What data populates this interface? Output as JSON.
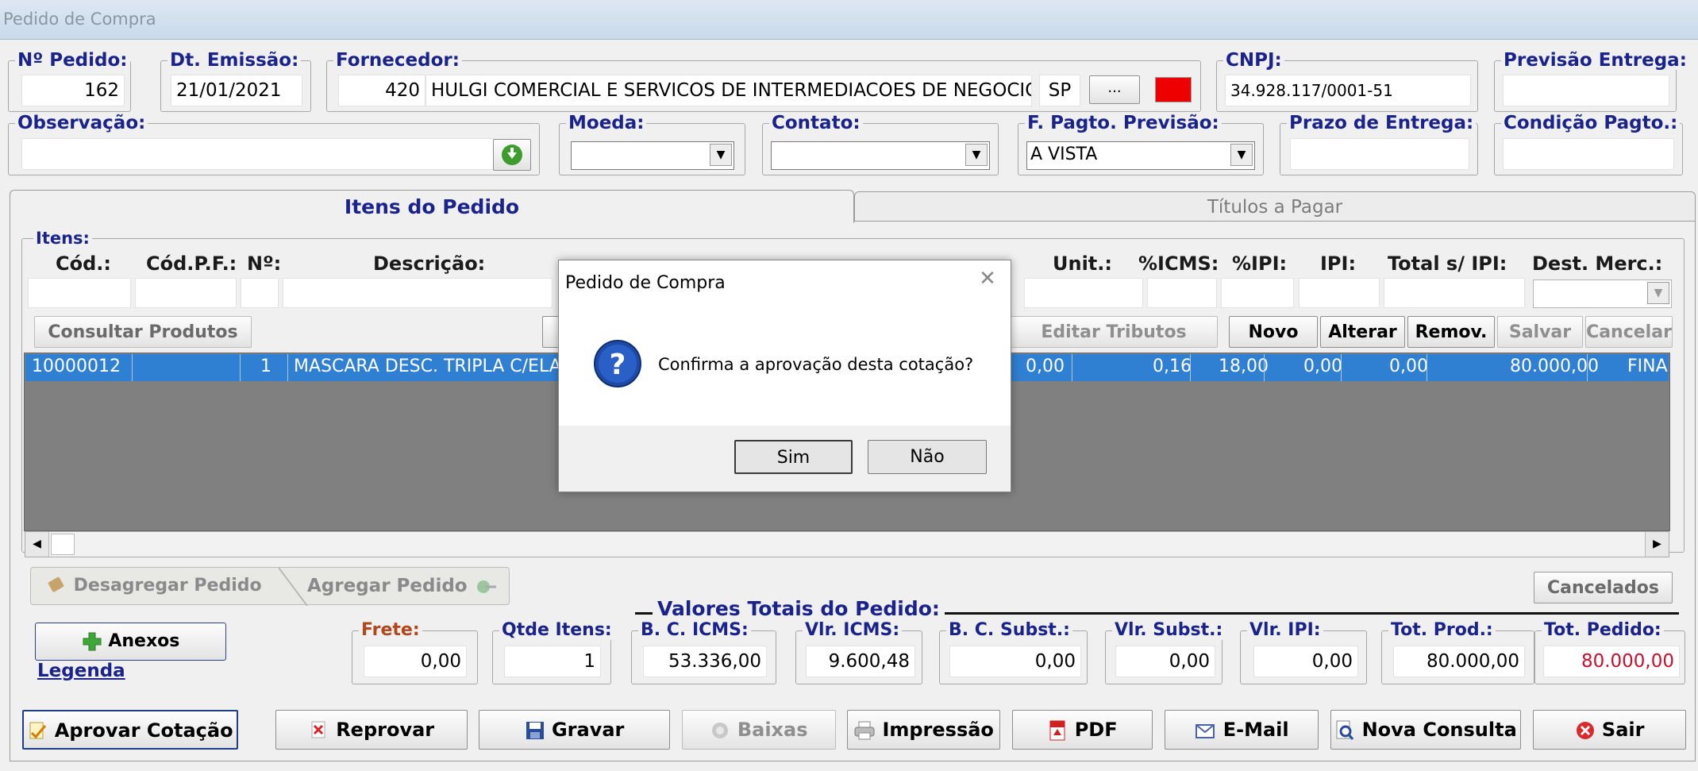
{
  "window_title": "Pedido de Compra",
  "header": {
    "pedido": {
      "label": "Nº Pedido:",
      "value": "162"
    },
    "emissao": {
      "label": "Dt. Emissão:",
      "value": "21/01/2021"
    },
    "fornecedor": {
      "label": "Fornecedor:",
      "code": "420",
      "name": "HULGI COMERCIAL E SERVICOS DE INTERMEDIACOES DE NEGOCIOS",
      "uf": "SP",
      "browse": "...",
      "color": "#ee0000"
    },
    "cnpj": {
      "label": "CNPJ:",
      "value": "34.928.117/0001-51"
    },
    "previsao": {
      "label": "Previsão Entrega:",
      "value": ""
    },
    "observacao": {
      "label": "Observação:",
      "value": ""
    },
    "moeda": {
      "label": "Moeda:",
      "value": ""
    },
    "contato": {
      "label": "Contato:",
      "value": ""
    },
    "fpagto": {
      "label": "F. Pagto. Previsão:",
      "value": "A VISTA"
    },
    "prazo": {
      "label": "Prazo de Entrega:",
      "value": ""
    },
    "condicao": {
      "label": "Condição Pagto.:",
      "value": ""
    }
  },
  "tabs": {
    "itens": "Itens do Pedido",
    "titulos": "Títulos a Pagar"
  },
  "itens": {
    "label": "Itens:",
    "columns": [
      "Cód.:",
      "Cód.P.F.:",
      "Nº:",
      "Descrição:",
      "Unit.:",
      "%ICMS:",
      "%IPI:",
      "IPI:",
      "Total s/ IPI:",
      "Dest. Merc.:"
    ],
    "buttons": {
      "consultar": "Consultar Produtos",
      "tributos": "Editar Tributos",
      "novo": "Novo",
      "alterar": "Alterar",
      "remov": "Remov.",
      "salvar": "Salvar",
      "cancelar": "Cancelar"
    },
    "rows": [
      {
        "cod": "10000012",
        "codpf": "",
        "num": "1",
        "desc": "MASCARA DESC. TRIPLA C/ELAS",
        "c1": "0,00",
        "c2": "0,16",
        "c3": "18,00",
        "c4": "0,00",
        "c5": "0,00",
        "total": "80.000,00",
        "dest": "FINA"
      }
    ]
  },
  "agg": {
    "desagregar": "Desagregar Pedido",
    "agregar": "Agregar Pedido",
    "cancelados": "Cancelados"
  },
  "anexos": "Anexos",
  "legenda": "Legenda",
  "totais": {
    "title": "Valores Totais do Pedido:",
    "frete": {
      "label": "Frete:",
      "value": "0,00"
    },
    "qtde": {
      "label": "Qtde Itens:",
      "value": "1"
    },
    "bcicms": {
      "label": "B. C. ICMS:",
      "value": "53.336,00"
    },
    "vlricms": {
      "label": "Vlr. ICMS:",
      "value": "9.600,48"
    },
    "bcsubst": {
      "label": "B. C. Subst.:",
      "value": "0,00"
    },
    "vlrsubst": {
      "label": "Vlr. Subst.:",
      "value": "0,00"
    },
    "vlripi": {
      "label": "Vlr. IPI:",
      "value": "0,00"
    },
    "totprod": {
      "label": "Tot. Prod.:",
      "value": "80.000,00"
    },
    "totped": {
      "label": "Tot. Pedido:",
      "value": "80.000,00"
    }
  },
  "bottom": {
    "aprovar": "Aprovar Cotação",
    "reprovar": "Reprovar",
    "gravar": "Gravar",
    "baixas": "Baixas",
    "impressao": "Impressão",
    "pdf": "PDF",
    "email": "E-Mail",
    "nova": "Nova Consulta",
    "sair": "Sair"
  },
  "dialog": {
    "title": "Pedido de Compra",
    "message": "Confirma a aprovação desta cotação?",
    "yes": "Sim",
    "no": "Não"
  }
}
